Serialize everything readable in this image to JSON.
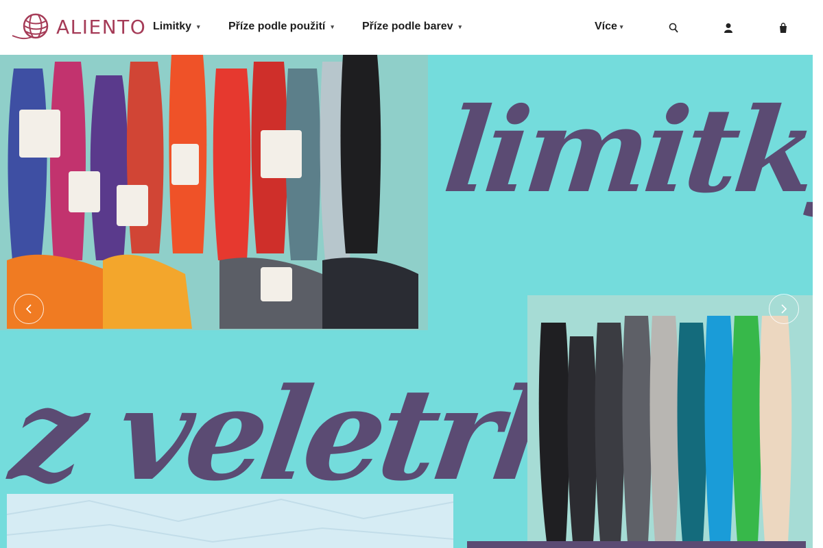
{
  "brand": {
    "name": "ALIENTO",
    "color": "#a53b57"
  },
  "nav": {
    "items": [
      {
        "label": "Limitky",
        "caret": "chevron-down-icon"
      },
      {
        "label": "Příze podle použití",
        "caret": "chevron-down-icon"
      },
      {
        "label": "Příze podle barev",
        "caret": "chevron-down-icon"
      }
    ],
    "more": {
      "label": "Více",
      "caret": "chevron-down-icon"
    }
  },
  "header_icons": [
    "search-icon",
    "user-icon",
    "cart-icon"
  ],
  "banner": {
    "line1": "limitky",
    "line2": "z veletrhu",
    "background": "#74dcdc",
    "text_color": "#5b4b73",
    "prev_icon": "chevron-left-icon",
    "next_icon": "chevron-right-icon"
  }
}
